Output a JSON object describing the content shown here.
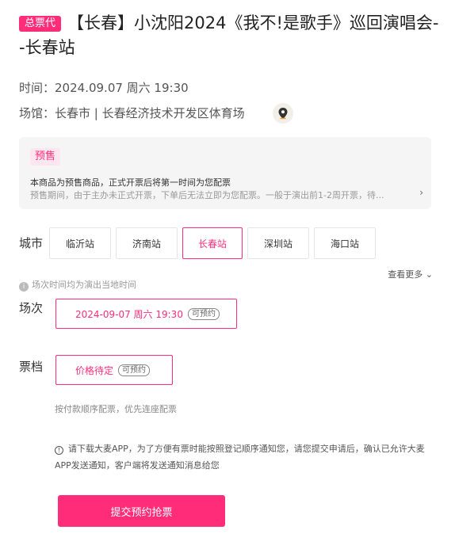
{
  "header": {
    "badge": "总票代",
    "title": "【长春】小沈阳2024《我不!是歌手》巡回演唱会--长春站"
  },
  "info": {
    "time_label": "时间：",
    "time_value": "2024.09.07 周六 19:30",
    "venue_label": "场馆：",
    "venue_value": "长春市 | 长春经济技术开发区体育场",
    "location_icon": "location-pin-icon"
  },
  "presale": {
    "tag": "预售",
    "line1": "本商品为预售商品，正式开票后将第一时间为您配票",
    "line2": "预售期间，由于主办未正式开票，下单后无法立即为您配票。一般于演出前1-2周开票，待..."
  },
  "city": {
    "label": "城市",
    "options": [
      "临沂站",
      "济南站",
      "长春站",
      "深圳站",
      "海口站"
    ],
    "selected": "长春站",
    "see_more": "查看更多"
  },
  "timezone_note": "场次时间均为演出当地时间",
  "session": {
    "label": "场次",
    "value": "2024-09-07 周六 19:30",
    "status": "可预约"
  },
  "ticket_tier": {
    "label": "票档",
    "value": "价格待定",
    "status": "可预约"
  },
  "pay_note": "按付款顺序配票，优先连座配票",
  "notice": "请下载大麦APP，为了方便有票时能按照登记顺序通知您，请您提交申请后，确认已允许大麦APP发送通知，客户端将发送通知消息给您",
  "submit_label": "提交预约抢票",
  "colors": {
    "accent": "#ff2d79",
    "presale_bg": "#f5f5f5"
  }
}
